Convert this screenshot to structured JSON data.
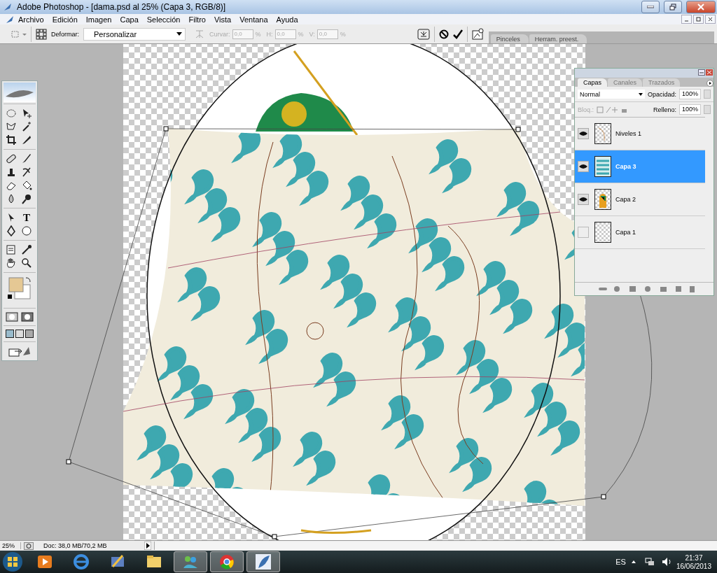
{
  "window": {
    "title": "Adobe Photoshop - [dama.psd al 25% (Capa 3, RGB/8)]"
  },
  "menu": [
    "Archivo",
    "Edición",
    "Imagen",
    "Capa",
    "Selección",
    "Filtro",
    "Vista",
    "Ventana",
    "Ayuda"
  ],
  "options_bar": {
    "deform_label": "Deformar:",
    "deform_value": "Personalizar",
    "fields": [
      {
        "label": "Curvar:",
        "value": "0,0",
        "unit": "%"
      },
      {
        "label": "H:",
        "value": "0,0",
        "unit": "%"
      },
      {
        "label": "V:",
        "value": "0,0",
        "unit": "%"
      }
    ],
    "palette_tabs": [
      "Pinceles",
      "Herram. preest."
    ]
  },
  "toolbox": {
    "type_glyph": "T"
  },
  "layers_panel": {
    "tabs": [
      {
        "label": "Capas",
        "selected": true
      },
      {
        "label": "Canales",
        "selected": false
      },
      {
        "label": "Trazados",
        "selected": false
      }
    ],
    "blend_mode": "Normal",
    "opacity_label": "Opacidad:",
    "opacity": "100%",
    "lock_label": "Bloq.:",
    "fill_label": "Relleno:",
    "fill": "100%",
    "layers": [
      {
        "name": "Niveles 1",
        "visible": true,
        "selected": false,
        "kind": "sketch"
      },
      {
        "name": "Capa 3",
        "visible": true,
        "selected": true,
        "kind": "pattern"
      },
      {
        "name": "Capa 2",
        "visible": true,
        "selected": false,
        "kind": "figure"
      },
      {
        "name": "Capa 1",
        "visible": false,
        "selected": false,
        "kind": "empty"
      }
    ]
  },
  "status_bar": {
    "zoom": "25%",
    "doc": "Doc: 38,0 MB/70,2 MB"
  },
  "taskbar": {
    "language": "ES",
    "time": "21:37",
    "date": "16/06/2013"
  }
}
